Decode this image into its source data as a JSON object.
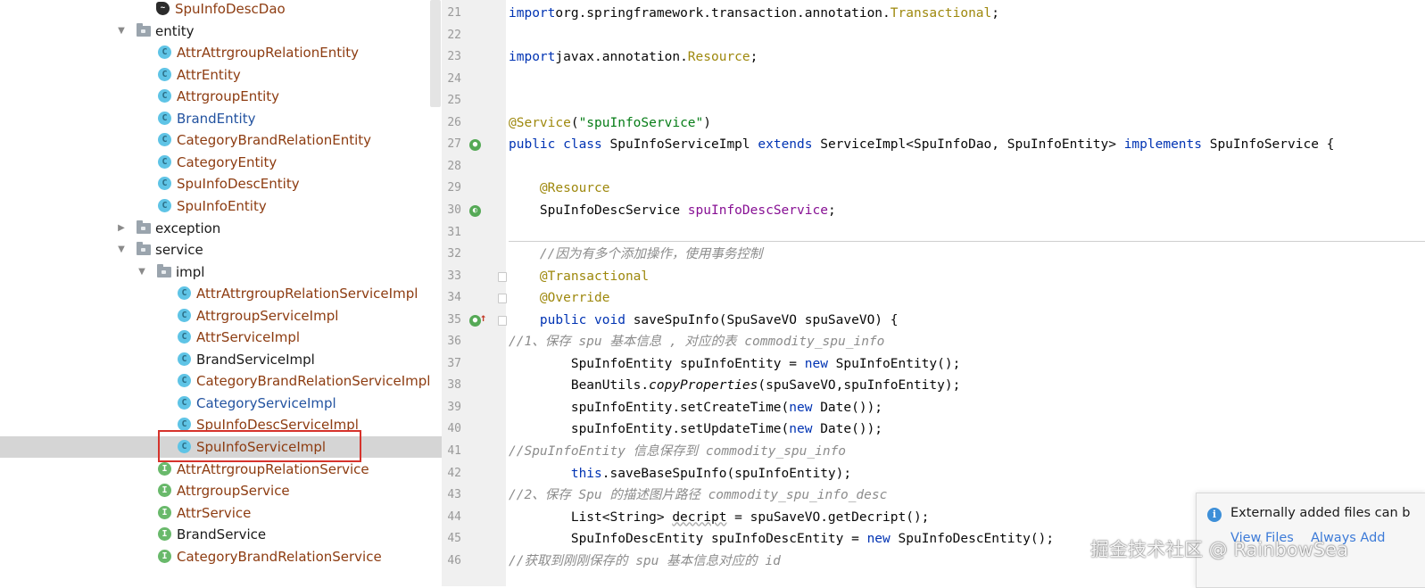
{
  "tree": {
    "rows": [
      {
        "label": "SpuInfoDescDao",
        "icon": "dao-icon",
        "arrow": "",
        "color": "mod"
      },
      {
        "label": "entity",
        "icon": "folder-icon",
        "arrow": "▼",
        "color": "black"
      },
      {
        "label": "AttrAttrgroupRelationEntity",
        "icon": "class-icon",
        "arrow": "",
        "color": "mod"
      },
      {
        "label": "AttrEntity",
        "icon": "class-icon",
        "arrow": "",
        "color": "mod"
      },
      {
        "label": "AttrgroupEntity",
        "icon": "class-icon",
        "arrow": "",
        "color": "mod"
      },
      {
        "label": "BrandEntity",
        "icon": "class-icon",
        "arrow": "",
        "color": "blue"
      },
      {
        "label": "CategoryBrandRelationEntity",
        "icon": "class-icon",
        "arrow": "",
        "color": "mod"
      },
      {
        "label": "CategoryEntity",
        "icon": "class-icon",
        "arrow": "",
        "color": "mod"
      },
      {
        "label": "SpuInfoDescEntity",
        "icon": "class-icon",
        "arrow": "",
        "color": "mod"
      },
      {
        "label": "SpuInfoEntity",
        "icon": "class-icon",
        "arrow": "",
        "color": "mod"
      },
      {
        "label": "exception",
        "icon": "folder-icon",
        "arrow": "▶",
        "color": "black"
      },
      {
        "label": "service",
        "icon": "folder-icon",
        "arrow": "▼",
        "color": "black"
      },
      {
        "label": "impl",
        "icon": "folder-icon",
        "arrow": "▼",
        "color": "black"
      },
      {
        "label": "AttrAttrgroupRelationServiceImpl",
        "icon": "class-icon",
        "arrow": "",
        "color": "mod"
      },
      {
        "label": "AttrgroupServiceImpl",
        "icon": "class-icon",
        "arrow": "",
        "color": "mod"
      },
      {
        "label": "AttrServiceImpl",
        "icon": "class-icon",
        "arrow": "",
        "color": "mod"
      },
      {
        "label": "BrandServiceImpl",
        "icon": "class-icon",
        "arrow": "",
        "color": "black"
      },
      {
        "label": "CategoryBrandRelationServiceImpl",
        "icon": "class-icon",
        "arrow": "",
        "color": "mod"
      },
      {
        "label": "CategoryServiceImpl",
        "icon": "class-icon",
        "arrow": "",
        "color": "blue"
      },
      {
        "label": "SpuInfoDescServiceImpl",
        "icon": "class-icon",
        "arrow": "",
        "color": "mod"
      },
      {
        "label": "SpuInfoServiceImpl",
        "icon": "class-icon",
        "arrow": "",
        "color": "mod"
      },
      {
        "label": "AttrAttrgroupRelationService",
        "icon": "interface-icon",
        "arrow": "",
        "color": "mod"
      },
      {
        "label": "AttrgroupService",
        "icon": "interface-icon",
        "arrow": "",
        "color": "mod"
      },
      {
        "label": "AttrService",
        "icon": "interface-icon",
        "arrow": "",
        "color": "mod"
      },
      {
        "label": "BrandService",
        "icon": "interface-icon",
        "arrow": "",
        "color": "black"
      },
      {
        "label": "CategoryBrandRelationService",
        "icon": "interface-icon",
        "arrow": "",
        "color": "mod"
      }
    ],
    "selected_label": "SpuInfoServiceImpl"
  },
  "editor": {
    "lines": [
      {
        "n": "21",
        "tokens": [
          [
            "k",
            "import"
          ],
          [
            "",
            "org.springframework.transaction.annotation."
          ],
          [
            "tx",
            "Transactional"
          ],
          [
            "",
            ";"
          ]
        ]
      },
      {
        "n": "22",
        "tokens": []
      },
      {
        "n": "23",
        "tokens": [
          [
            "k",
            "import"
          ],
          [
            "",
            "javax.annotation."
          ],
          [
            "tx",
            "Resource"
          ],
          [
            "",
            ";"
          ]
        ]
      },
      {
        "n": "24",
        "tokens": []
      },
      {
        "n": "25",
        "tokens": []
      },
      {
        "n": "26",
        "tokens": [
          [
            "an",
            "@Service"
          ],
          [
            "",
            "("
          ],
          [
            "str",
            "\"spuInfoService\""
          ],
          [
            "",
            ")"
          ]
        ]
      },
      {
        "n": "27",
        "tokens": [
          [
            "k",
            "public class "
          ],
          [
            "",
            "SpuInfoServiceImpl "
          ],
          [
            "k",
            "extends "
          ],
          [
            "",
            "ServiceImpl<SpuInfoDao, SpuInfoEntity> "
          ],
          [
            "k",
            "implements "
          ],
          [
            "",
            "SpuInfoService {"
          ]
        ]
      },
      {
        "n": "28",
        "tokens": []
      },
      {
        "n": "29",
        "tokens": [
          [
            "",
            "    "
          ],
          [
            "an",
            "@Resource"
          ]
        ]
      },
      {
        "n": "30",
        "tokens": [
          [
            "",
            "    SpuInfoDescService "
          ],
          [
            "fld",
            "spuInfoDescService"
          ],
          [
            "",
            ";"
          ]
        ]
      },
      {
        "n": "31",
        "tokens": []
      },
      {
        "n": "32",
        "tokens": [
          [
            "",
            "    "
          ],
          [
            "cm",
            "//因为有多个添加操作，使用事务控制"
          ]
        ]
      },
      {
        "n": "33",
        "tokens": [
          [
            "",
            "    "
          ],
          [
            "an",
            "@Transactional"
          ]
        ]
      },
      {
        "n": "34",
        "tokens": [
          [
            "",
            "    "
          ],
          [
            "an",
            "@Override"
          ]
        ]
      },
      {
        "n": "35",
        "tokens": [
          [
            "",
            "    "
          ],
          [
            "k",
            "public void "
          ],
          [
            "",
            "saveSpuInfo(SpuSaveVO spuSaveVO) {"
          ]
        ]
      },
      {
        "n": "36",
        "tokens": [
          [
            "cm",
            "//1、保存 spu 基本信息 , 对应的表 commodity_spu_info"
          ]
        ]
      },
      {
        "n": "37",
        "tokens": [
          [
            "",
            "        SpuInfoEntity spuInfoEntity = "
          ],
          [
            "k",
            "new "
          ],
          [
            "",
            "SpuInfoEntity();"
          ]
        ]
      },
      {
        "n": "38",
        "tokens": [
          [
            "",
            "        BeanUtils."
          ],
          [
            "it",
            "copyProperties"
          ],
          [
            "",
            "(spuSaveVO,spuInfoEntity);"
          ]
        ]
      },
      {
        "n": "39",
        "tokens": [
          [
            "",
            "        spuInfoEntity.setCreateTime("
          ],
          [
            "k",
            "new "
          ],
          [
            "",
            "Date());"
          ]
        ]
      },
      {
        "n": "40",
        "tokens": [
          [
            "",
            "        spuInfoEntity.setUpdateTime("
          ],
          [
            "k",
            "new "
          ],
          [
            "",
            "Date());"
          ]
        ]
      },
      {
        "n": "41",
        "tokens": [
          [
            "cm",
            "//SpuInfoEntity 信息保存到 commodity_spu_info"
          ]
        ]
      },
      {
        "n": "42",
        "tokens": [
          [
            "",
            "        "
          ],
          [
            "k",
            "this"
          ],
          [
            "",
            ".saveBaseSpuInfo(spuInfoEntity);"
          ]
        ]
      },
      {
        "n": "43",
        "tokens": [
          [
            "cm",
            "//2、保存 Spu 的描述图片路径 commodity_spu_info_desc"
          ]
        ]
      },
      {
        "n": "44",
        "tokens": [
          [
            "",
            "        List<String> "
          ],
          [
            "warn",
            "decript"
          ],
          [
            "",
            " = spuSaveVO.getDecript();"
          ]
        ]
      },
      {
        "n": "45",
        "tokens": [
          [
            "",
            "        SpuInfoDescEntity spuInfoDescEntity = "
          ],
          [
            "k",
            "new "
          ],
          [
            "",
            "SpuInfoDescEntity();"
          ]
        ]
      },
      {
        "n": "46",
        "tokens": [
          [
            "cm",
            "//获取到刚刚保存的 spu 基本信息对应的 id"
          ]
        ]
      }
    ],
    "gutter_icons": {
      "27": "implements-icon",
      "30": "bean-icon",
      "35": "override-up-icon"
    },
    "fold_markers": [
      "33",
      "34",
      "35"
    ]
  },
  "notification": {
    "message": "Externally added files can b",
    "actions": [
      "View Files",
      "Always Add"
    ]
  },
  "watermark": "掘金技术社区 @ RainbowSea",
  "colors": {
    "modified": "#8d3c11",
    "new_file": "#2353a0",
    "keyword": "#0033b3",
    "annotation": "#9e880d",
    "string": "#067d17",
    "field": "#871094",
    "comment": "#8c8c8c",
    "selection_box": "#d6332c"
  }
}
